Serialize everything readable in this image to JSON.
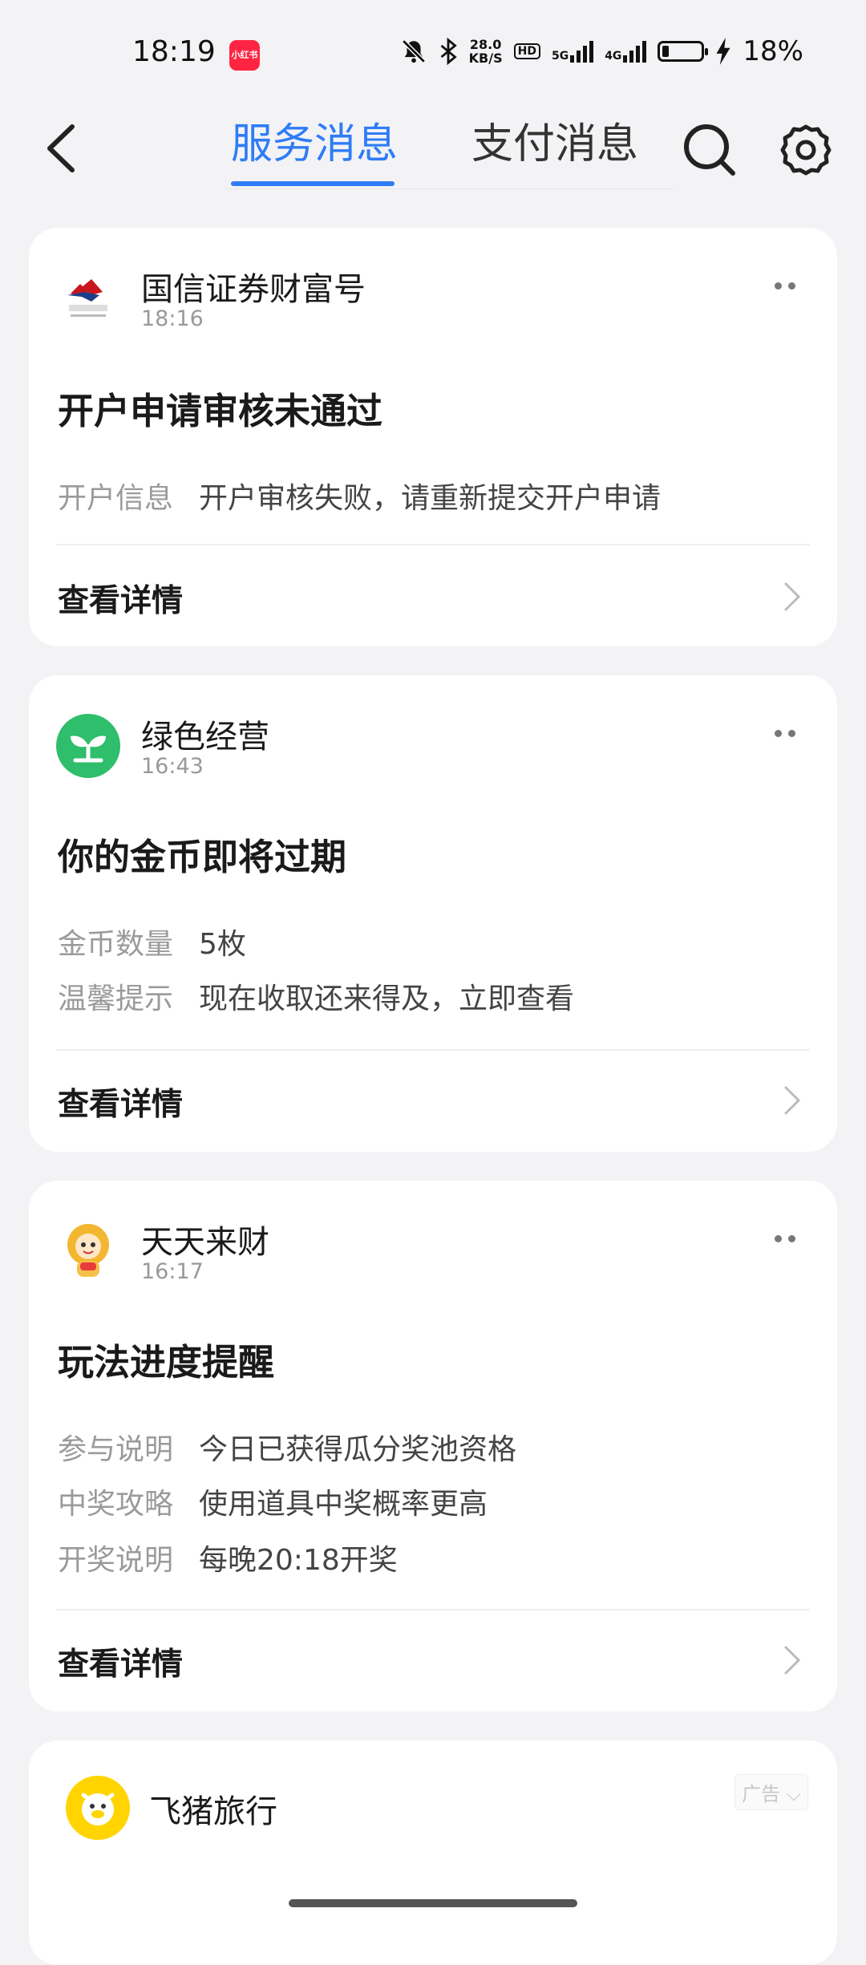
{
  "status_bar": {
    "time": "18:19",
    "app_badge": "小红书",
    "net_speed_value": "28.0",
    "net_speed_unit": "KB/S",
    "hd_label": "HD",
    "sig1_label": "5G",
    "sig2_label": "4G",
    "battery_percent": "18%",
    "battery_level": 0.18
  },
  "nav": {
    "tabs": [
      {
        "label": "服务消息",
        "active": true
      },
      {
        "label": "支付消息",
        "active": false
      }
    ]
  },
  "cards": [
    {
      "name": "国信证券财富号",
      "time": "18:16",
      "title": "开户申请审核未通过",
      "rows": [
        {
          "key": "开户信息",
          "value": "开户审核失败，请重新提交开户申请"
        }
      ],
      "detail_label": "查看详情"
    },
    {
      "name": "绿色经营",
      "time": "16:43",
      "title": "你的金币即将过期",
      "rows": [
        {
          "key": "金币数量",
          "value": "5枚"
        },
        {
          "key": "温馨提示",
          "value": "现在收取还来得及，立即查看"
        }
      ],
      "detail_label": "查看详情"
    },
    {
      "name": "天天来财",
      "time": "16:17",
      "title": "玩法进度提醒",
      "rows": [
        {
          "key": "参与说明",
          "value": "今日已获得瓜分奖池资格"
        },
        {
          "key": "中奖攻略",
          "value": "使用道具中奖概率更高"
        },
        {
          "key": "开奖说明",
          "value": "每晚20:18开奖"
        }
      ],
      "detail_label": "查看详情"
    },
    {
      "name": "飞猪旅行",
      "ad_label": "广告"
    }
  ],
  "colors": {
    "accent": "#2f7cf6",
    "page_bg": "#f3f3f5",
    "card_bg": "#ffffff"
  },
  "icons": {
    "back": "chevron-left-icon",
    "search": "search-icon",
    "settings": "gear-icon",
    "more": "more-dots-icon",
    "detail": "chevron-right-icon"
  }
}
